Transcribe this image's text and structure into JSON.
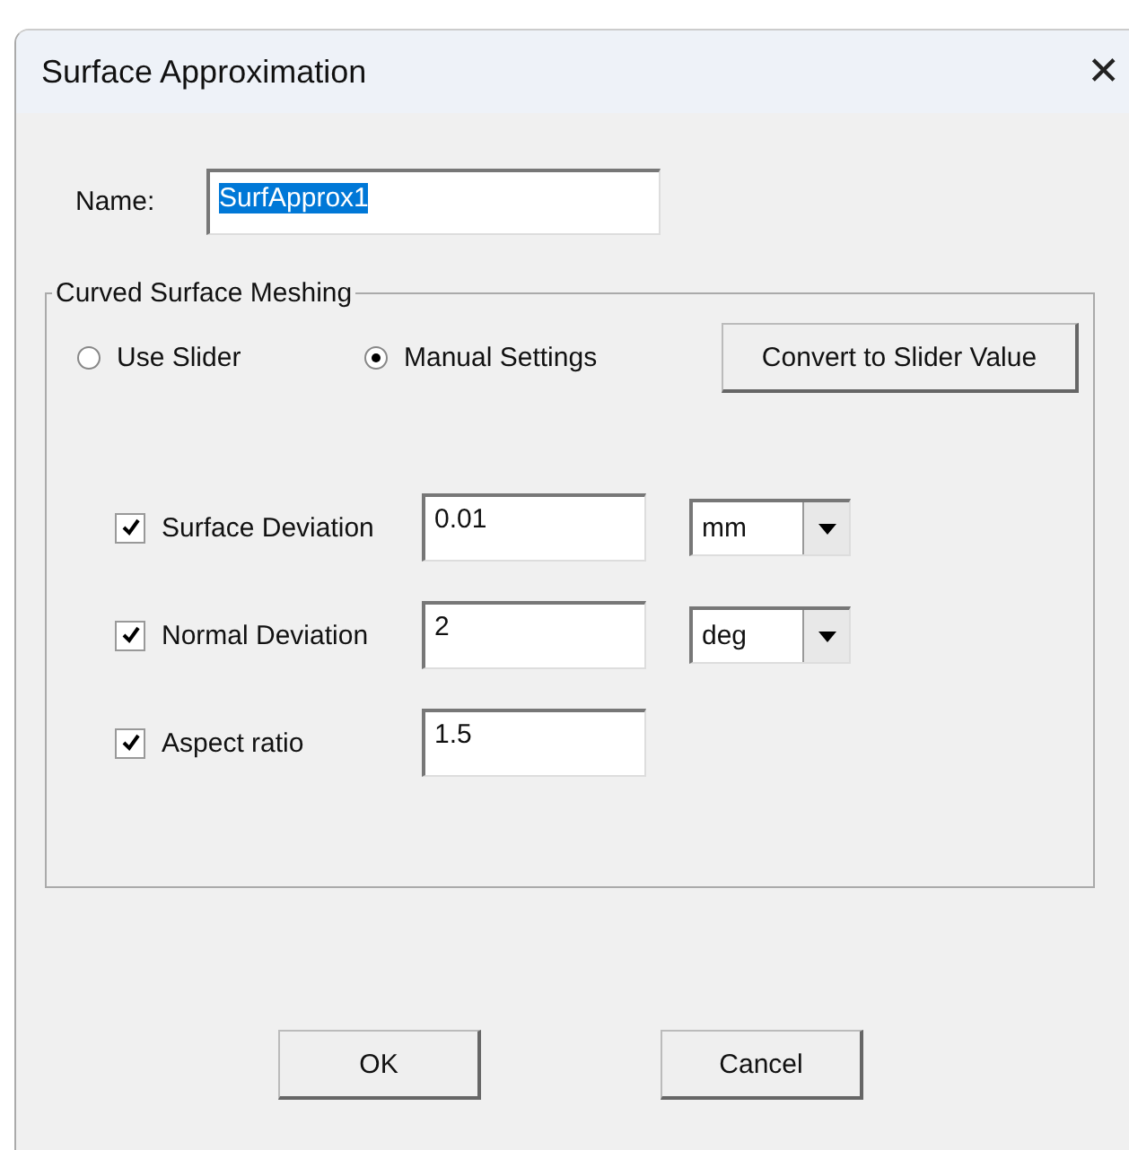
{
  "window": {
    "title": "Surface Approximation",
    "close": "✕"
  },
  "name_field": {
    "label": "Name:",
    "value": "SurfApprox1",
    "text_selected": true
  },
  "group": {
    "title": "Curved Surface Meshing",
    "modes": [
      {
        "label": "Use Slider",
        "selected": false
      },
      {
        "label": "Manual Settings",
        "selected": true
      }
    ],
    "convert_button": "Convert to Slider Value",
    "settings": [
      {
        "label": "Surface Deviation",
        "checked": true,
        "value": "0.01",
        "unit": "mm"
      },
      {
        "label": "Normal Deviation",
        "checked": true,
        "value": "2",
        "unit": "deg"
      },
      {
        "label": "Aspect ratio",
        "checked": true,
        "value": "1.5"
      }
    ]
  },
  "buttons": [
    "OK",
    "Cancel"
  ]
}
